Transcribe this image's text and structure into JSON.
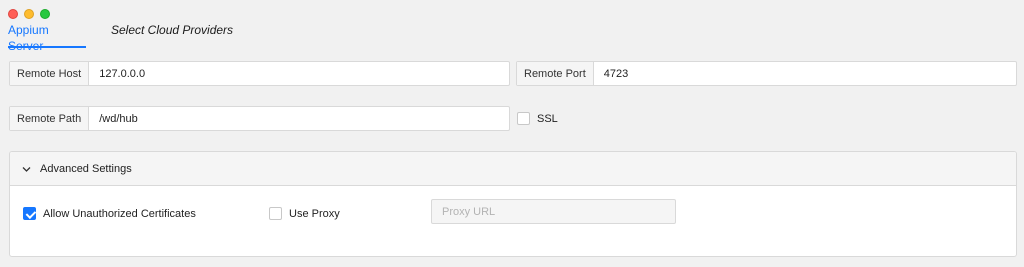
{
  "window": {
    "controls": [
      "close",
      "minimize",
      "zoom"
    ]
  },
  "tabs": {
    "active": "Appium Server",
    "inactive": "Select Cloud Providers"
  },
  "server": {
    "host_label": "Remote Host",
    "host_value": "127.0.0.0",
    "port_label": "Remote Port",
    "port_value": "4723",
    "path_label": "Remote Path",
    "path_value": "/wd/hub",
    "ssl_label": "SSL",
    "ssl_checked": false
  },
  "advanced": {
    "title": "Advanced Settings",
    "expanded": true,
    "allow_unauthorized_label": "Allow Unauthorized Certificates",
    "allow_unauthorized_checked": true,
    "use_proxy_label": "Use Proxy",
    "use_proxy_checked": false,
    "proxy_url_placeholder": "Proxy URL"
  },
  "colors": {
    "accent": "#1677ff",
    "close": "#ff5f57",
    "minimize": "#febc2e",
    "zoom": "#28c840"
  }
}
